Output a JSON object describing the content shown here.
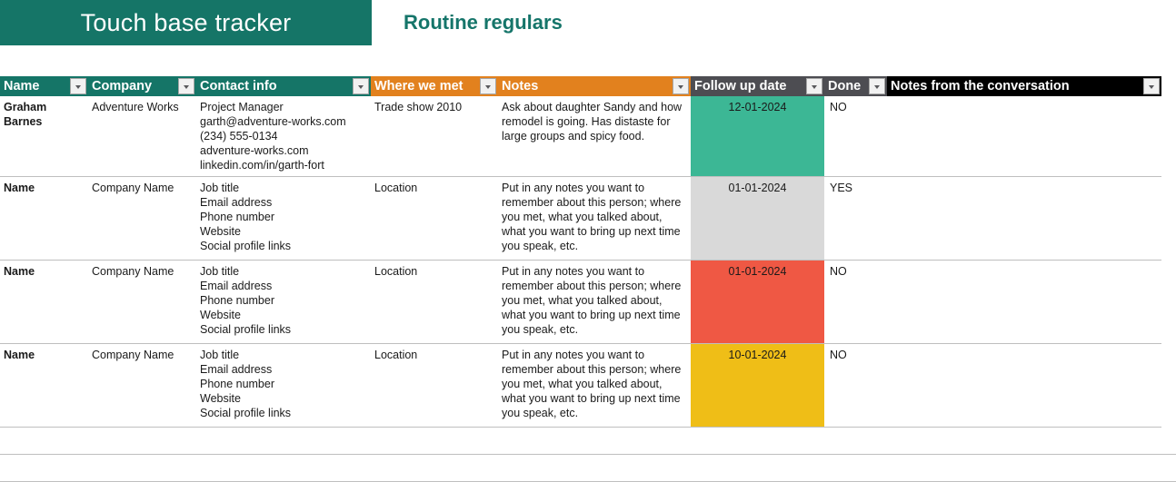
{
  "header": {
    "title": "Touch base tracker",
    "subtitle": "Routine regulars",
    "banner_color": "#157567",
    "subtitle_color": "#15756A"
  },
  "table": {
    "columns": [
      {
        "label": "Name",
        "style": "teal",
        "filter": true
      },
      {
        "label": "Company",
        "style": "teal",
        "filter": true
      },
      {
        "label": "Contact info",
        "style": "teal",
        "filter": true
      },
      {
        "label": "Where we met",
        "style": "orange",
        "filter": true
      },
      {
        "label": "Notes",
        "style": "orange",
        "filter": true
      },
      {
        "label": "Follow up date",
        "style": "gray",
        "filter": true
      },
      {
        "label": "Done",
        "style": "gray",
        "filter": true
      },
      {
        "label": "Notes from the conversation",
        "style": "black",
        "filter": true
      }
    ],
    "header_colors": {
      "teal": "#157567",
      "orange": "#E2811E",
      "gray": "#4D4D52",
      "black": "#000000"
    },
    "rows": [
      {
        "name": "Graham Barnes",
        "company": "Adventure Works",
        "contact": [
          "Project Manager",
          "garth@adventure-works.com",
          "(234) 555-0134",
          "adventure-works.com",
          "linkedin.com/in/garth-fort"
        ],
        "where": "Trade show 2010",
        "notes": "Ask about daughter Sandy and how remodel is going. Has distaste for large groups and spicy food.",
        "follow_up": "12-01-2024",
        "follow_up_fill": "#3CB795",
        "done": "NO",
        "conversation": ""
      },
      {
        "name": "Name",
        "company": "Company Name",
        "contact": [
          "Job title",
          "Email address",
          "Phone number",
          "Website",
          "Social profile links"
        ],
        "where": "Location",
        "notes": "Put in any notes you want to remember about this person; where you met, what you talked about, what you want to bring up next time you speak, etc.",
        "follow_up": "01-01-2024",
        "follow_up_fill": "#D9D9D9",
        "done": "YES",
        "conversation": ""
      },
      {
        "name": "Name",
        "company": "Company Name",
        "contact": [
          "Job title",
          "Email address",
          "Phone number",
          "Website",
          "Social profile links"
        ],
        "where": "Location",
        "notes": "Put in any notes you want to remember about this person; where you met, what you talked about, what you want to bring up next time you speak, etc.",
        "follow_up": "01-01-2024",
        "follow_up_fill": "#EF5844",
        "done": "NO",
        "conversation": ""
      },
      {
        "name": "Name",
        "company": "Company Name",
        "contact": [
          "Job title",
          "Email address",
          "Phone number",
          "Website",
          "Social profile links"
        ],
        "where": "Location",
        "notes": "Put in any notes you want to remember about this person; where you met, what you talked about, what you want to bring up next time you speak, etc.",
        "follow_up": "10-01-2024",
        "follow_up_fill": "#EFBE17",
        "done": "NO",
        "conversation": ""
      }
    ],
    "empty_rows": 2,
    "filter_icon": "chevron-down-icon"
  }
}
